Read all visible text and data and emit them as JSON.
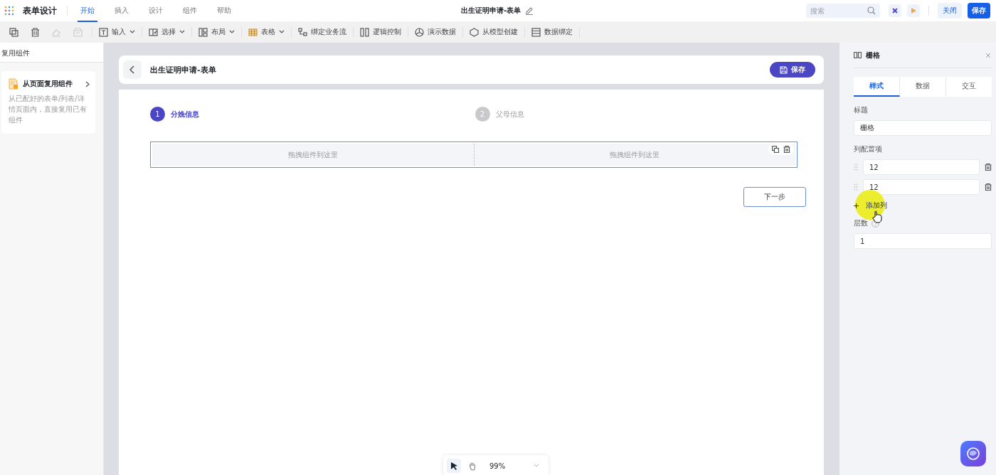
{
  "app": {
    "title": "表单设计",
    "menu": [
      {
        "label": "开始",
        "selected": true
      },
      {
        "label": "插入",
        "selected": false
      },
      {
        "label": "设计",
        "selected": false
      },
      {
        "label": "组件",
        "selected": false
      },
      {
        "label": "帮助",
        "selected": false
      }
    ],
    "doc_title": "出生证明申请-表单",
    "search": {
      "placeholder": "搜索"
    },
    "close_button": "关闭",
    "save_button": "保存"
  },
  "toolbar": [
    {
      "kind": "icon",
      "disabled": false
    },
    {
      "kind": "icon",
      "disabled": false
    },
    {
      "kind": "icon",
      "disabled": true
    },
    {
      "kind": "icon",
      "disabled": true
    },
    {
      "kind": "dropdown",
      "label": "输入"
    },
    {
      "kind": "dropdown",
      "label": "选择"
    },
    {
      "kind": "dropdown",
      "label": "布局"
    },
    {
      "kind": "dropdown",
      "label": "表格"
    },
    {
      "kind": "action",
      "label": "绑定业务流"
    },
    {
      "kind": "action",
      "label": "逻辑控制"
    },
    {
      "kind": "action",
      "label": "演示数据"
    },
    {
      "kind": "action",
      "label": "从模型创建"
    },
    {
      "kind": "action",
      "label": "数据绑定"
    }
  ],
  "left_panel": {
    "title": "复用组件",
    "card": {
      "title": "从页面复用组件",
      "description": "从已配好的表单/列表/详情页面内，直接复用已有组件"
    }
  },
  "canvas": {
    "form_title": "出生证明申请-表单",
    "save_button": "保存",
    "steps": [
      {
        "number": "1",
        "label": "分娩信息",
        "selected": true
      },
      {
        "number": "2",
        "label": "父母信息",
        "selected": false
      }
    ],
    "grid_cells": [
      "拖拽组件到这里",
      "拖拽组件到这里"
    ],
    "next_button": "下一步"
  },
  "right_panel": {
    "title": "栅格",
    "tabs": [
      {
        "label": "样式",
        "selected": true
      },
      {
        "label": "数据",
        "selected": false
      },
      {
        "label": "交互",
        "selected": false
      }
    ],
    "title_label": "标题",
    "title_value": "栅格",
    "columns_label": "列配置项",
    "columns": [
      "12",
      "12"
    ],
    "add_column": "添加列",
    "layers_label": "层数",
    "layers_value": "1"
  },
  "zoom_bar": {
    "tools": [
      {
        "selected": true
      },
      {
        "selected": false
      }
    ],
    "zoom": "99%"
  }
}
